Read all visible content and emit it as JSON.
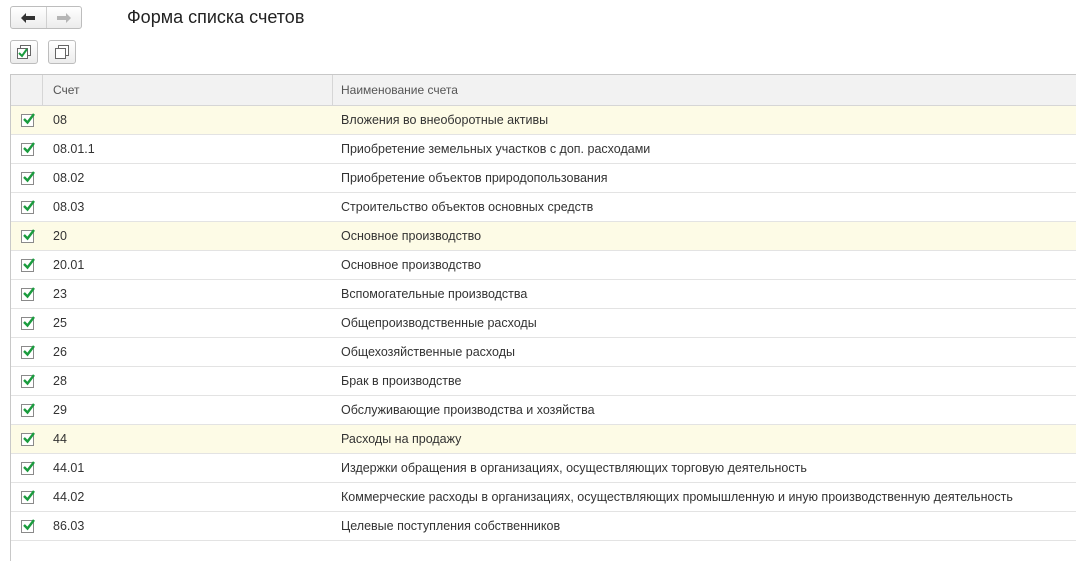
{
  "window": {
    "title": "Форма списка счетов"
  },
  "nav": {
    "back_icon": "arrow-left-icon",
    "forward_icon": "arrow-right-icon"
  },
  "commands": [
    {
      "icon": "check-all-icon"
    },
    {
      "icon": "uncheck-all-icon"
    }
  ],
  "table": {
    "columns": {
      "code": "Счет",
      "name": "Наименование счета"
    },
    "rows": [
      {
        "code": "08",
        "name": "Вложения во внеоборотные активы",
        "checked": true,
        "group": true
      },
      {
        "code": "08.01.1",
        "name": "Приобретение земельных участков с доп. расходами",
        "checked": true,
        "group": false
      },
      {
        "code": "08.02",
        "name": "Приобретение объектов природопользования",
        "checked": true,
        "group": false
      },
      {
        "code": "08.03",
        "name": "Строительство объектов основных средств",
        "checked": true,
        "group": false
      },
      {
        "code": "20",
        "name": "Основное производство",
        "checked": true,
        "group": true
      },
      {
        "code": "20.01",
        "name": "Основное производство",
        "checked": true,
        "group": false
      },
      {
        "code": "23",
        "name": "Вспомогательные производства",
        "checked": true,
        "group": false
      },
      {
        "code": "25",
        "name": "Общепроизводственные расходы",
        "checked": true,
        "group": false
      },
      {
        "code": "26",
        "name": "Общехозяйственные расходы",
        "checked": true,
        "group": false
      },
      {
        "code": "28",
        "name": "Брак в производстве",
        "checked": true,
        "group": false
      },
      {
        "code": "29",
        "name": "Обслуживающие производства и хозяйства",
        "checked": true,
        "group": false
      },
      {
        "code": "44",
        "name": "Расходы на продажу",
        "checked": true,
        "group": true
      },
      {
        "code": "44.01",
        "name": "Издержки обращения в организациях, осуществляющих торговую деятельность",
        "checked": true,
        "group": false
      },
      {
        "code": "44.02",
        "name": "Коммерческие расходы в организациях, осуществляющих промышленную и иную производственную деятельность",
        "checked": true,
        "group": false
      },
      {
        "code": "86.03",
        "name": "Целевые поступления собственников",
        "checked": true,
        "group": false
      }
    ]
  },
  "colors": {
    "check": "#1a9c3e",
    "group_row_bg": "#fdfbe6"
  }
}
